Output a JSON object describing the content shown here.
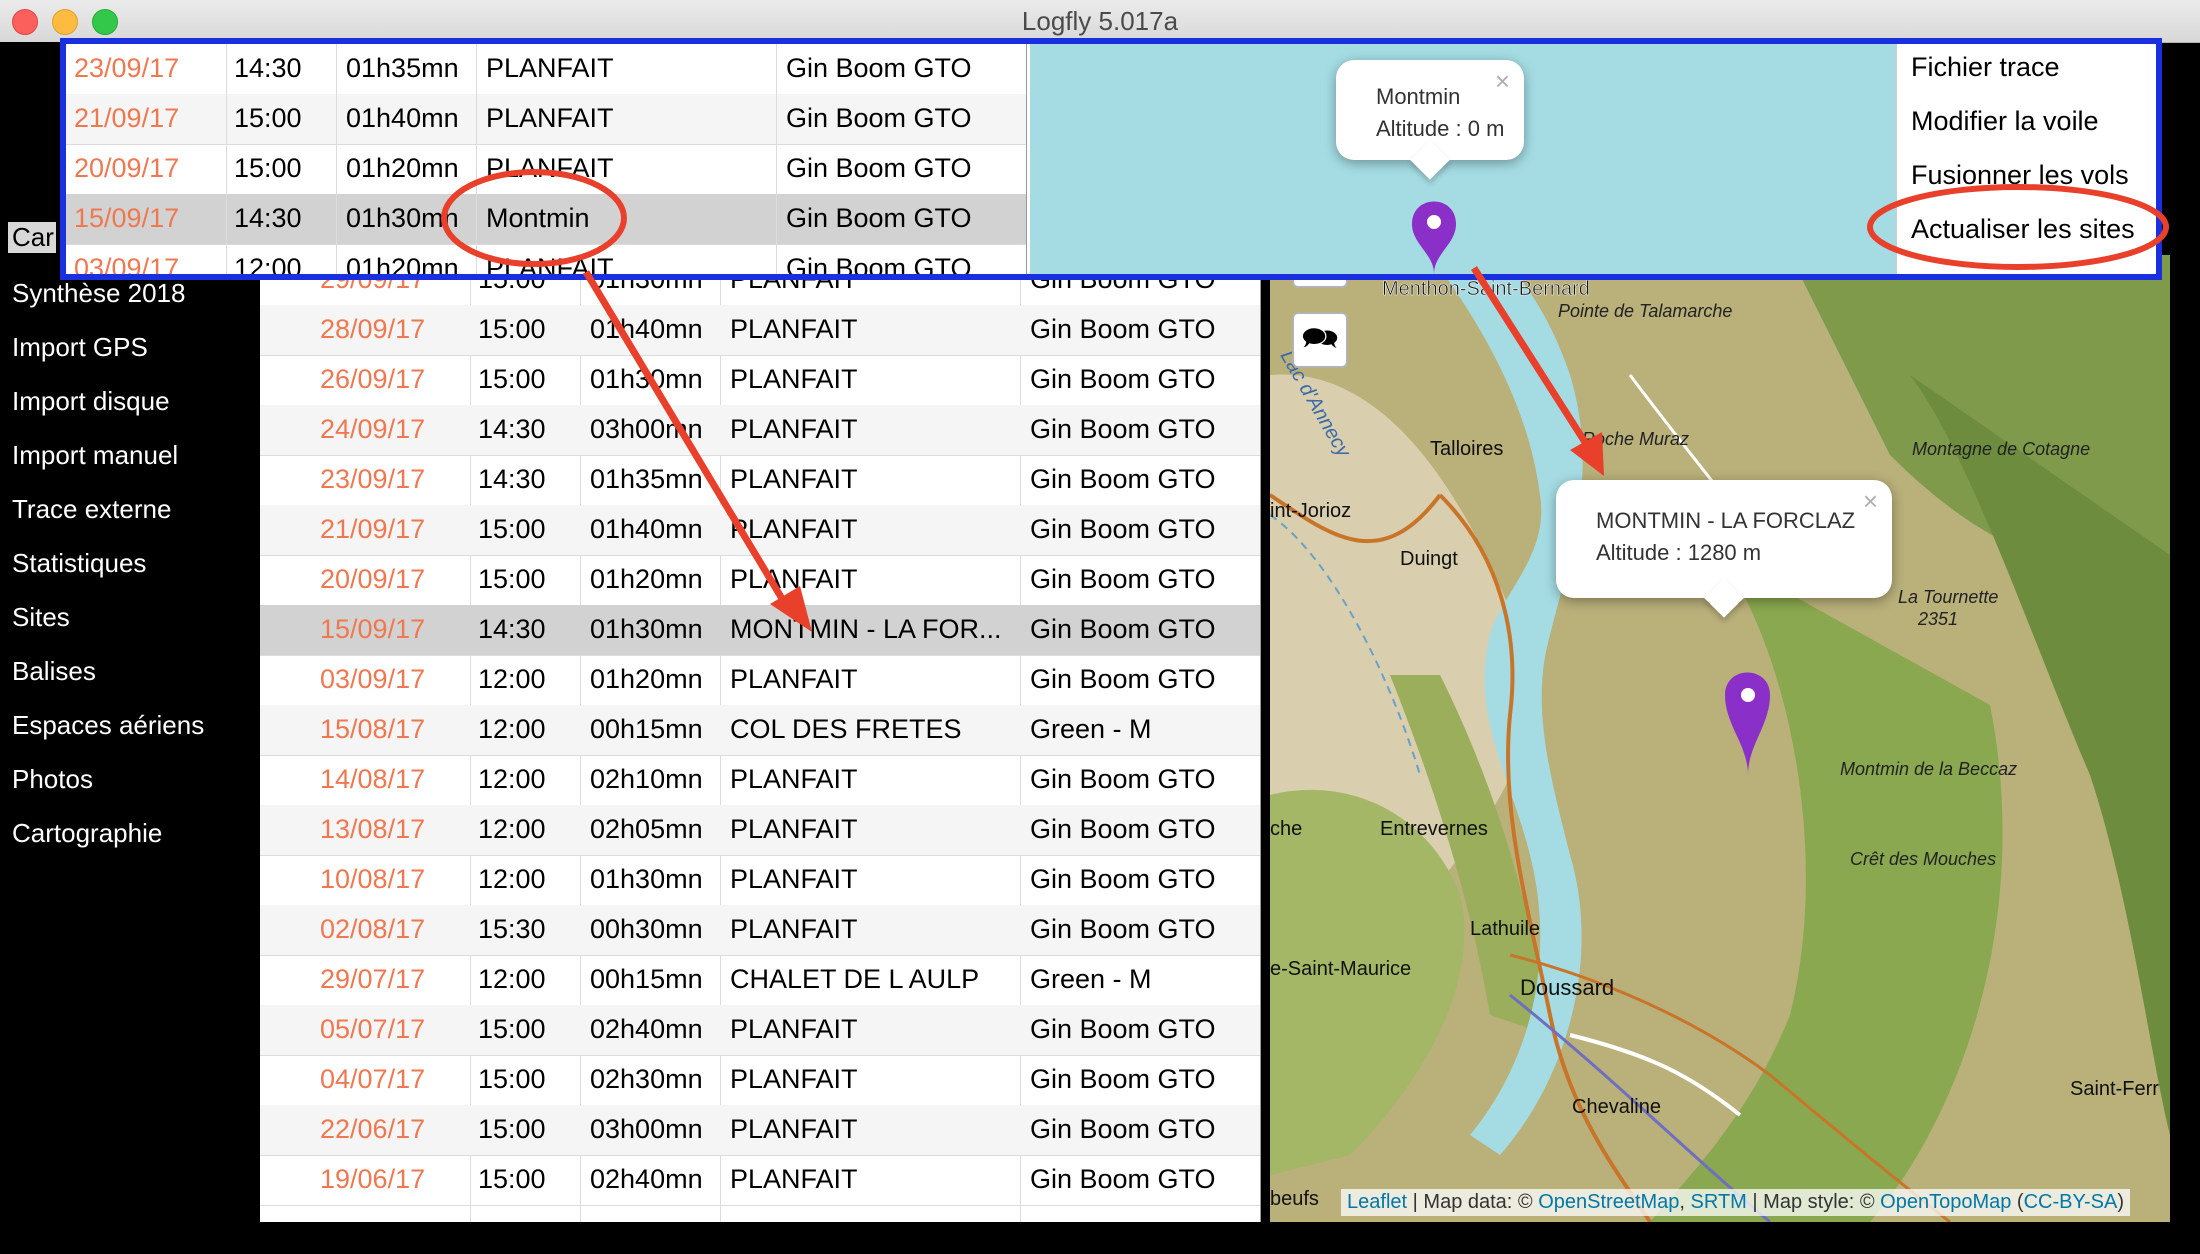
{
  "window": {
    "title": "Logfly 5.017a"
  },
  "sidebar": {
    "cut_item": "Car",
    "items": [
      "Synthèse 2018",
      "Import GPS",
      "Import disque",
      "Import manuel",
      "Trace externe",
      "Statistiques",
      "Sites",
      "Balises",
      "Espaces aériens",
      "Photos",
      "Cartographie"
    ]
  },
  "flights": [
    {
      "date": "29/09/17",
      "time": "15:00",
      "duration": "01h30mn",
      "site": "PLANFAIT",
      "wing": "Gin Boom GTO"
    },
    {
      "date": "28/09/17",
      "time": "15:00",
      "duration": "01h40mn",
      "site": "PLANFAIT",
      "wing": "Gin Boom GTO"
    },
    {
      "date": "26/09/17",
      "time": "15:00",
      "duration": "01h30mn",
      "site": "PLANFAIT",
      "wing": "Gin Boom GTO"
    },
    {
      "date": "24/09/17",
      "time": "14:30",
      "duration": "03h00mn",
      "site": "PLANFAIT",
      "wing": "Gin Boom GTO"
    },
    {
      "date": "23/09/17",
      "time": "14:30",
      "duration": "01h35mn",
      "site": "PLANFAIT",
      "wing": "Gin Boom GTO"
    },
    {
      "date": "21/09/17",
      "time": "15:00",
      "duration": "01h40mn",
      "site": "PLANFAIT",
      "wing": "Gin Boom GTO"
    },
    {
      "date": "20/09/17",
      "time": "15:00",
      "duration": "01h20mn",
      "site": "PLANFAIT",
      "wing": "Gin Boom GTO"
    },
    {
      "date": "15/09/17",
      "time": "14:30",
      "duration": "01h30mn",
      "site": "MONTMIN - LA FOR...",
      "wing": "Gin Boom GTO"
    },
    {
      "date": "03/09/17",
      "time": "12:00",
      "duration": "01h20mn",
      "site": "PLANFAIT",
      "wing": "Gin Boom GTO"
    },
    {
      "date": "15/08/17",
      "time": "12:00",
      "duration": "00h15mn",
      "site": "COL DES FRETES",
      "wing": "Green - M"
    },
    {
      "date": "14/08/17",
      "time": "12:00",
      "duration": "02h10mn",
      "site": "PLANFAIT",
      "wing": "Gin Boom GTO"
    },
    {
      "date": "13/08/17",
      "time": "12:00",
      "duration": "02h05mn",
      "site": "PLANFAIT",
      "wing": "Gin Boom GTO"
    },
    {
      "date": "10/08/17",
      "time": "12:00",
      "duration": "01h30mn",
      "site": "PLANFAIT",
      "wing": "Gin Boom GTO"
    },
    {
      "date": "02/08/17",
      "time": "15:30",
      "duration": "00h30mn",
      "site": "PLANFAIT",
      "wing": "Gin Boom GTO"
    },
    {
      "date": "29/07/17",
      "time": "12:00",
      "duration": "00h15mn",
      "site": "CHALET DE L AULP",
      "wing": "Green - M"
    },
    {
      "date": "05/07/17",
      "time": "15:00",
      "duration": "02h40mn",
      "site": "PLANFAIT",
      "wing": "Gin Boom GTO"
    },
    {
      "date": "04/07/17",
      "time": "15:00",
      "duration": "02h30mn",
      "site": "PLANFAIT",
      "wing": "Gin Boom GTO"
    },
    {
      "date": "22/06/17",
      "time": "15:00",
      "duration": "03h00mn",
      "site": "PLANFAIT",
      "wing": "Gin Boom GTO"
    },
    {
      "date": "19/06/17",
      "time": "15:00",
      "duration": "02h40mn",
      "site": "PLANFAIT",
      "wing": "Gin Boom GTO"
    }
  ],
  "overlay_flights": [
    {
      "date": "23/09/17",
      "time": "14:30",
      "duration": "01h35mn",
      "site": "PLANFAIT",
      "wing": "Gin Boom GTO"
    },
    {
      "date": "21/09/17",
      "time": "15:00",
      "duration": "01h40mn",
      "site": "PLANFAIT",
      "wing": "Gin Boom GTO"
    },
    {
      "date": "20/09/17",
      "time": "15:00",
      "duration": "01h20mn",
      "site": "PLANFAIT",
      "wing": "Gin Boom GTO"
    },
    {
      "date": "15/09/17",
      "time": "14:30",
      "duration": "01h30mn",
      "site": "Montmin",
      "wing": "Gin Boom GTO"
    },
    {
      "date": "03/09/17",
      "time": "12:00",
      "duration": "01h20mn",
      "site": "PLANFAIT",
      "wing": "Gin Boom GTO"
    }
  ],
  "context_menu": [
    "Fichier trace",
    "Modifier la voile",
    "Fusionner les vols",
    "Actualiser les sites"
  ],
  "popup_before": {
    "name": "Montmin",
    "altitude": "Altitude : 0 m"
  },
  "popup_after": {
    "name": "MONTMIN - LA FORCLAZ",
    "altitude": "Altitude : 1280 m"
  },
  "map": {
    "places": [
      "Menthon-Saint-Bernard",
      "Pointe de Talamarche",
      "Lac d'Annecy",
      "Talloires",
      "Roche Muraz",
      "Montagne de Cotagne",
      "int-Jorioz",
      "Duingt",
      "La Tournette",
      "2351",
      "Montmin de la Beccaz",
      "Crêt des Mouches",
      "Entrevernes",
      "Lathuile",
      "Doussard",
      "e-Saint-Maurice",
      "Chevaline",
      "Saint-Ferr",
      "che",
      "beufs"
    ],
    "attribution": {
      "leaflet": "Leaflet",
      "sep1": " | Map data: © ",
      "osm": "OpenStreetMap",
      "sep2": ", ",
      "srtm": "SRTM",
      "sep3": " | Map style: © ",
      "otm": "OpenTopoMap",
      "sep4": " (",
      "license": "CC-BY-SA",
      "sep5": ")"
    }
  },
  "colors": {
    "date": "#f07850",
    "overlay_border": "#1a2fe0",
    "annotation": "#e8402a",
    "marker": "#8b2fc9",
    "lake": "#a5dce4"
  }
}
